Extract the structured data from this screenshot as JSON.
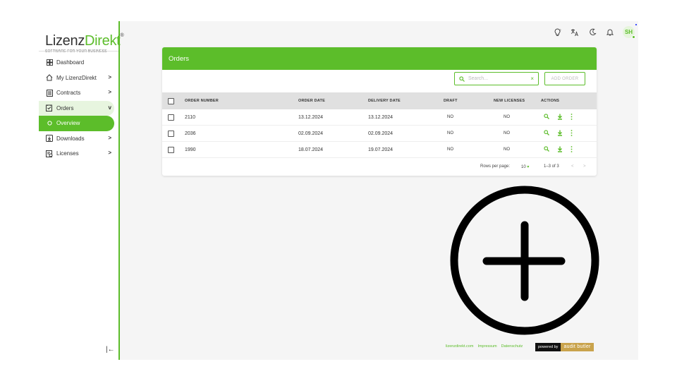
{
  "logo": {
    "brand_a": "Lizenz",
    "brand_b": "Direkt",
    "reg": "®",
    "tagline": "SOFTWARE FOR YOUR BUSINESS"
  },
  "sidebar": {
    "items": [
      {
        "label": "Dashboard",
        "icon": "dashboard-icon"
      },
      {
        "label": "My LizenzDirekt",
        "icon": "home-icon",
        "chevron": ">"
      },
      {
        "label": "Contracts",
        "icon": "contracts-icon",
        "chevron": ">"
      },
      {
        "label": "Orders",
        "icon": "orders-icon",
        "chevron": "v"
      },
      {
        "label": "Overview",
        "icon": "circle-icon"
      },
      {
        "label": "Downloads",
        "icon": "download-box-icon",
        "chevron": ">"
      },
      {
        "label": "Licenses",
        "icon": "licenses-icon",
        "chevron": ">"
      }
    ],
    "collapse_glyph": "|←"
  },
  "topbar": {
    "avatar_initials": "SH"
  },
  "orders": {
    "title": "Orders",
    "search_placeholder": "Search...",
    "search_clear": "×",
    "add_button": "ADD ORDER",
    "columns": [
      "ORDER NUMBER",
      "ORDER DATE",
      "DELIVERY DATE",
      "DRAFT",
      "NEW LICENSES",
      "ACTIONS"
    ],
    "rows": [
      {
        "number": "2110",
        "order_date": "13.12.2024",
        "delivery_date": "13.12.2024",
        "draft": "NO",
        "new_licenses": "NO"
      },
      {
        "number": "2036",
        "order_date": "02.09.2024",
        "delivery_date": "02.09.2024",
        "draft": "NO",
        "new_licenses": "NO"
      },
      {
        "number": "1990",
        "order_date": "18.07.2024",
        "delivery_date": "19.07.2024",
        "draft": "NO",
        "new_licenses": "NO"
      }
    ],
    "pagination": {
      "rows_per_page_label": "Rows per page:",
      "rows_per_page": "10",
      "range": "1–3 of 3",
      "prev": "<",
      "next": ">"
    }
  },
  "footer": {
    "links": [
      "lizenzdirekt.com",
      "Impressum",
      "Datenschutz"
    ],
    "powered_by": "powered by",
    "powered_brand": "audit butler"
  },
  "colors": {
    "accent": "#5cbd2a",
    "header_bg": "#e0e0e0",
    "page_bg": "#f5f5f5"
  }
}
